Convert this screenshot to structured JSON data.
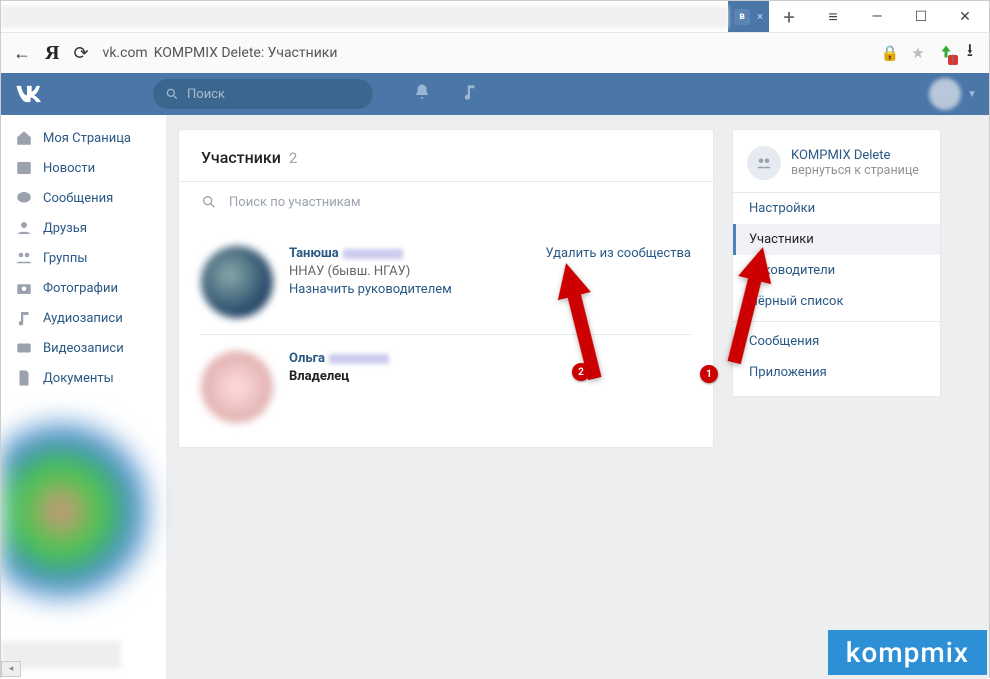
{
  "titlebar": {
    "active_tab_label": "в",
    "newtab_symbol": "+",
    "menu_symbol": "≡",
    "min_symbol": "—",
    "max_symbol": "☐",
    "close_symbol": "✕"
  },
  "addressbar": {
    "back_symbol": "←",
    "brand_letter": "Я",
    "reload_symbol": "⟳",
    "host": "vk.com",
    "page_title": "KOMPMIX Delete: Участники",
    "lock_symbol": "🔒",
    "star_symbol": "★",
    "download_symbol": "⭳"
  },
  "vk": {
    "search_placeholder": "Поиск"
  },
  "leftnav": {
    "items": [
      {
        "label": "Моя Страница",
        "icon": "home"
      },
      {
        "label": "Новости",
        "icon": "news"
      },
      {
        "label": "Сообщения",
        "icon": "msg"
      },
      {
        "label": "Друзья",
        "icon": "user"
      },
      {
        "label": "Группы",
        "icon": "users"
      },
      {
        "label": "Фотографии",
        "icon": "photo"
      },
      {
        "label": "Аудиозаписи",
        "icon": "music"
      },
      {
        "label": "Видеозаписи",
        "icon": "video"
      },
      {
        "label": "Документы",
        "icon": "doc"
      }
    ]
  },
  "main": {
    "title": "Участники",
    "count": "2",
    "search_placeholder": "Поиск по участникам",
    "members": [
      {
        "name": "Танюша",
        "info": "ННАУ (бывш. НГАУ)",
        "assign_role_label": "Назначить руководителем",
        "remove_label": "Удалить из сообщества"
      },
      {
        "name": "Ольга",
        "role": "Владелец"
      }
    ]
  },
  "right": {
    "group_name": "KOMPMIX Delete",
    "back_label": "вернуться к странице",
    "items": [
      {
        "label": "Настройки"
      },
      {
        "label": "Участники",
        "active": true
      },
      {
        "label": "Руководители"
      },
      {
        "label": "Чёрный список"
      },
      {
        "label": "Сообщения"
      },
      {
        "label": "Приложения"
      }
    ]
  },
  "annotations": {
    "num1": "1",
    "num2": "2"
  },
  "watermark": "kompmix"
}
